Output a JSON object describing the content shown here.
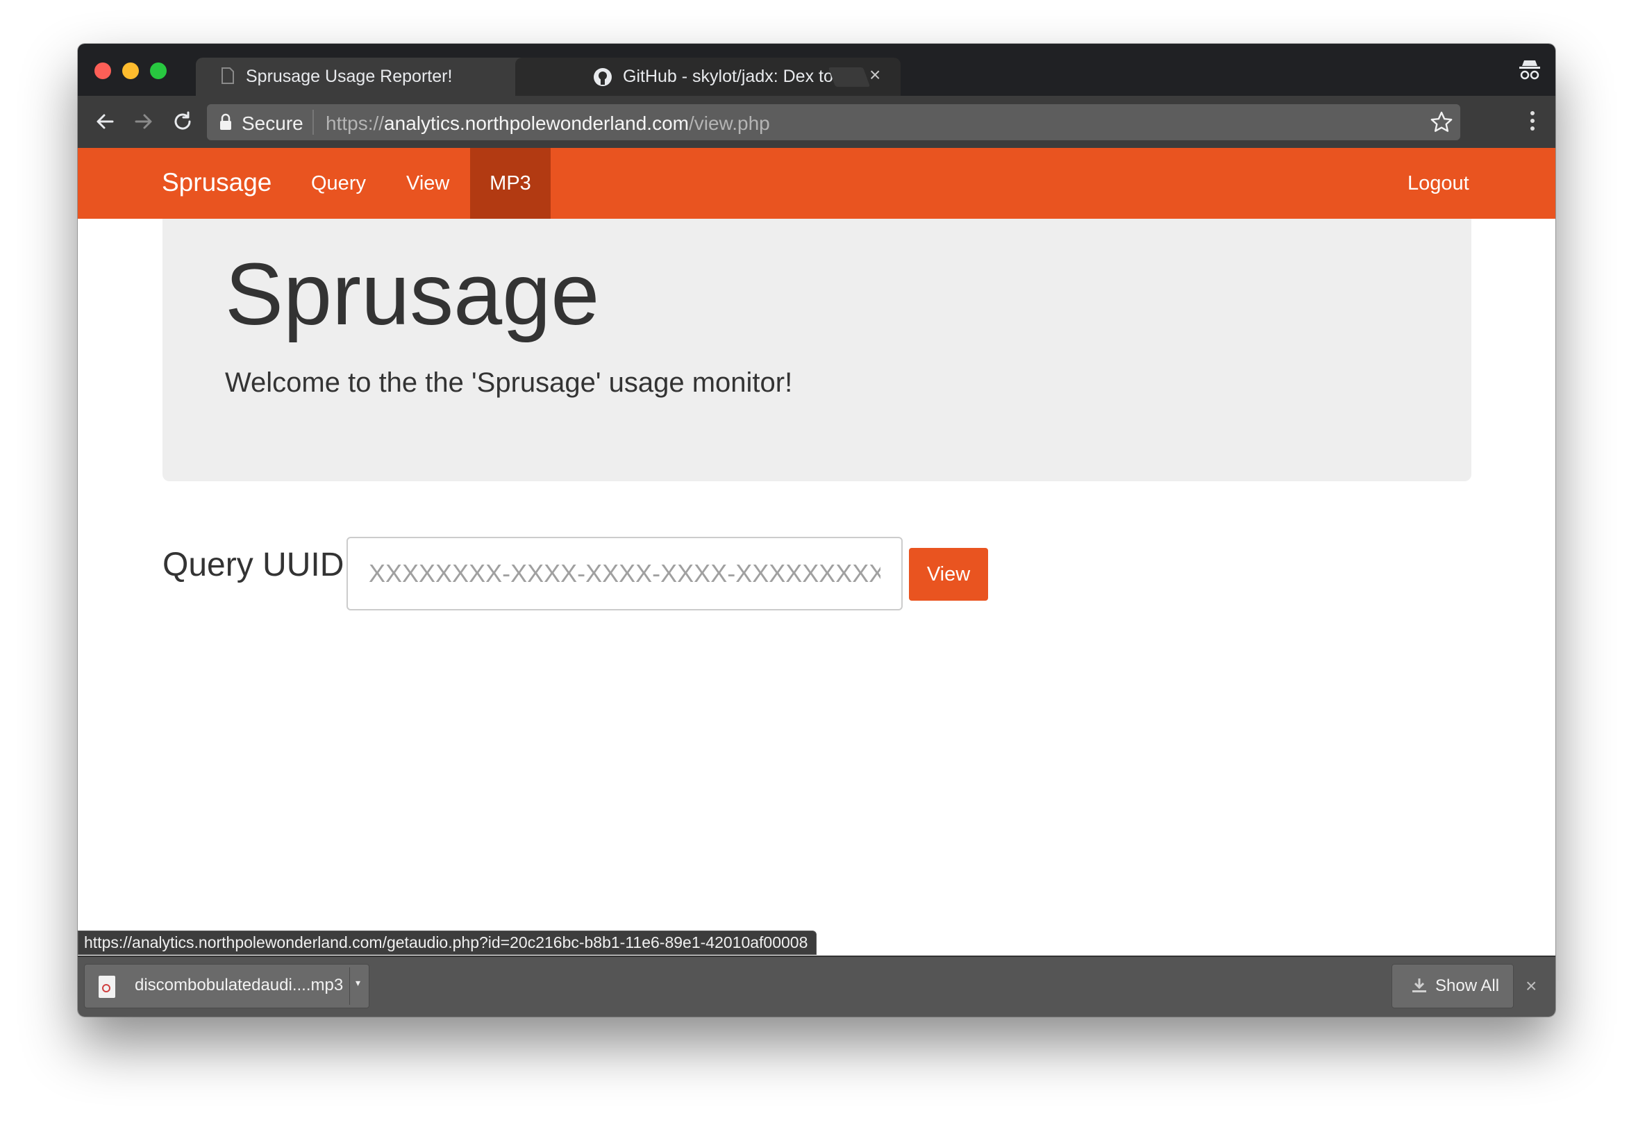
{
  "browser": {
    "tabs": [
      {
        "title": "Sprusage Usage Reporter!",
        "active": true
      },
      {
        "title": "GitHub - skylot/jadx: Dex to Ja",
        "active": false
      }
    ],
    "close_glyph": "×",
    "security_label": "Secure",
    "url": {
      "scheme": "https://",
      "host": "analytics.northpolewonderland.com",
      "path": "/view.php"
    }
  },
  "site": {
    "brand": "Sprusage",
    "nav": [
      {
        "label": "Query",
        "active": false
      },
      {
        "label": "View",
        "active": false
      },
      {
        "label": "MP3",
        "active": true
      }
    ],
    "logout_label": "Logout",
    "accent_color": "#e95420",
    "active_nav_color": "#b23a12"
  },
  "hero": {
    "title": "Sprusage",
    "subtitle": "Welcome to the the 'Sprusage' usage monitor!"
  },
  "query_form": {
    "label": "Query UUID",
    "input_placeholder": "XXXXXXXX-XXXX-XXXX-XXXX-XXXXXXXXXX",
    "input_value": "",
    "button_label": "View"
  },
  "status_bar": {
    "link_url": "https://analytics.northpolewonderland.com/getaudio.php?id=20c216bc-b8b1-11e6-89e1-42010af00008"
  },
  "downloads": {
    "items": [
      {
        "filename": "discombobulatedaudi....mp3"
      }
    ],
    "show_all_label": "Show All",
    "close_glyph": "×",
    "caret_glyph": "▾"
  }
}
